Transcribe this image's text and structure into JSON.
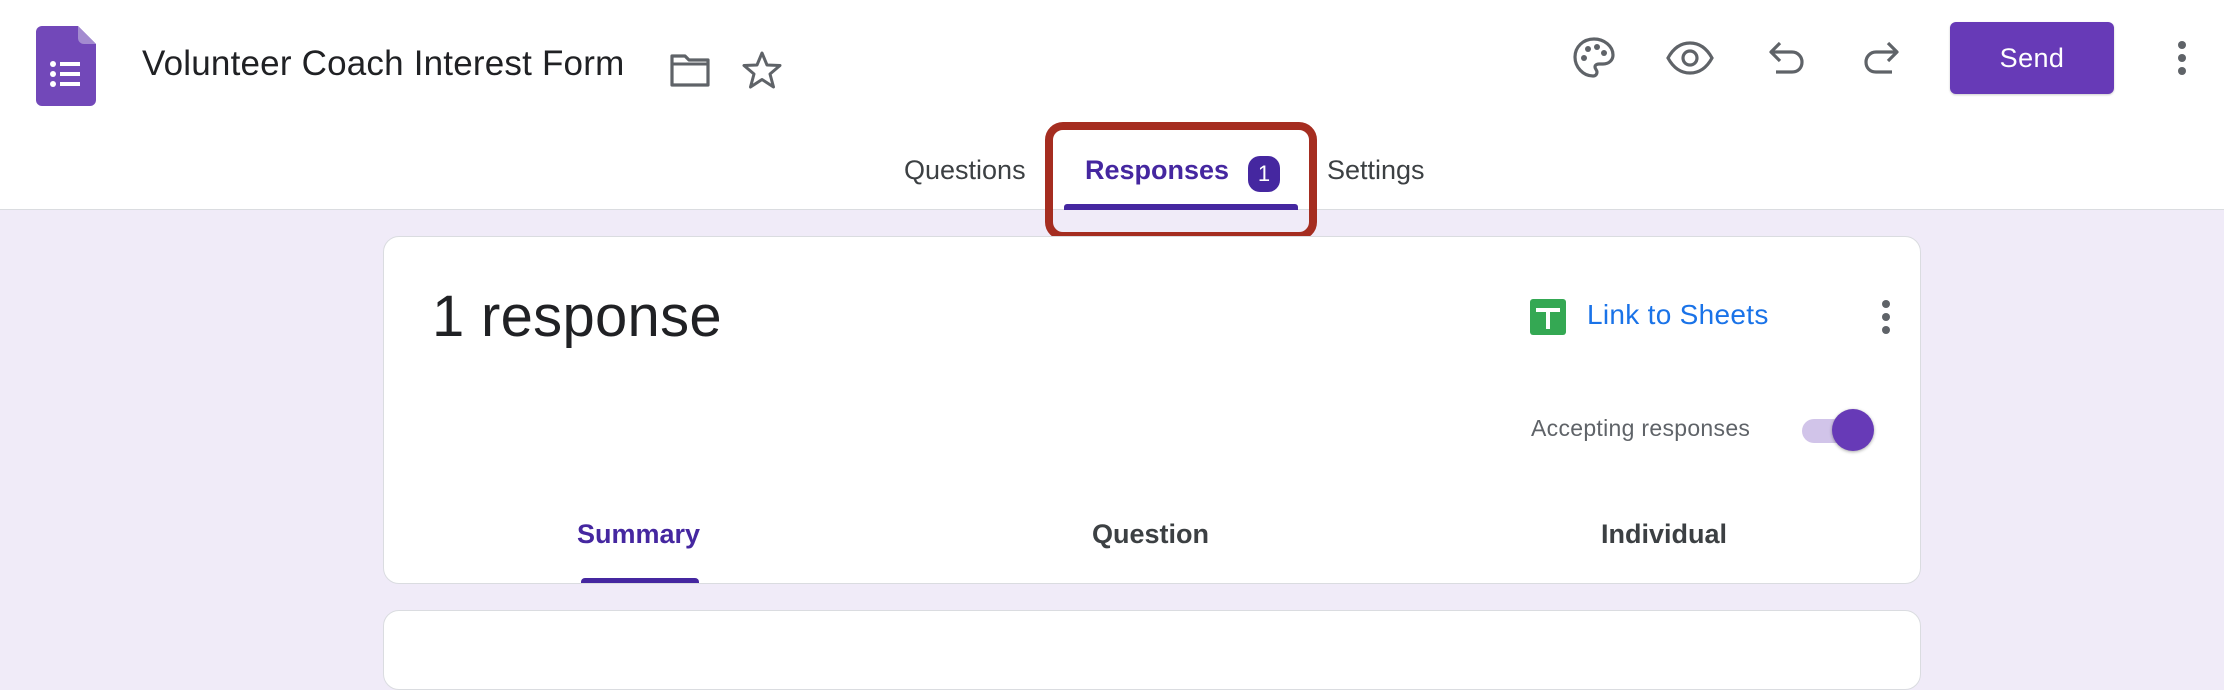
{
  "header": {
    "title": "Volunteer Coach Interest Form",
    "send_label": "Send",
    "icons": [
      "forms-logo-icon",
      "folder-icon",
      "star-icon",
      "palette-icon",
      "eye-icon",
      "undo-icon",
      "redo-icon",
      "more-vert-icon"
    ]
  },
  "tabs": {
    "questions": "Questions",
    "responses": "Responses",
    "responses_badge": "1",
    "settings": "Settings",
    "active": "Responses"
  },
  "responses_card": {
    "count_text": "1 response",
    "link_to_sheets": "Link to Sheets",
    "accepting_label": "Accepting responses",
    "accepting": true,
    "subtabs": {
      "summary": "Summary",
      "question": "Question",
      "individual": "Individual",
      "active": "Summary"
    }
  },
  "colors": {
    "accent": "#673ab7",
    "accent_dark": "#4527a0",
    "background": "#f0ebf8",
    "link": "#1a73e8",
    "highlight": "#a52d20"
  }
}
